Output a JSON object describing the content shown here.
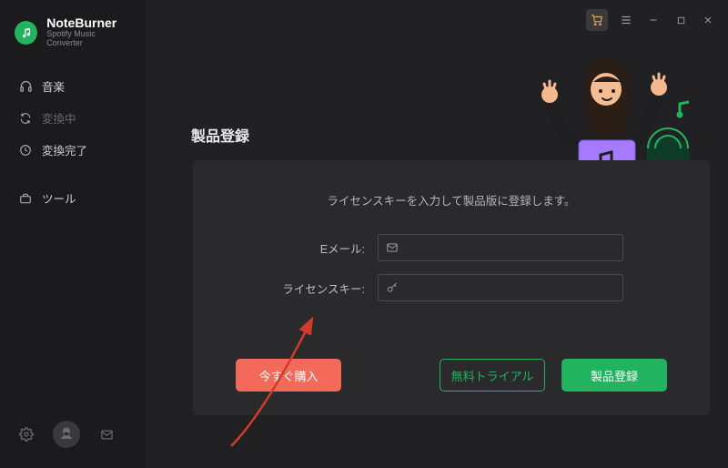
{
  "brand": {
    "name": "NoteBurner",
    "sub": "Spotify Music Converter"
  },
  "sidebar": {
    "items": [
      {
        "label": "音楽"
      },
      {
        "label": "変換中"
      },
      {
        "label": "変換完了"
      },
      {
        "label": "ツール"
      }
    ]
  },
  "page": {
    "title": "製品登録",
    "desc": "ライセンスキーを入力して製品版に登録します。",
    "email_label": "Eメール:",
    "key_label": "ライセンスキー:",
    "email_value": "",
    "key_value": ""
  },
  "buttons": {
    "buy": "今すぐ購入",
    "trial": "無料トライアル",
    "register": "製品登録"
  }
}
